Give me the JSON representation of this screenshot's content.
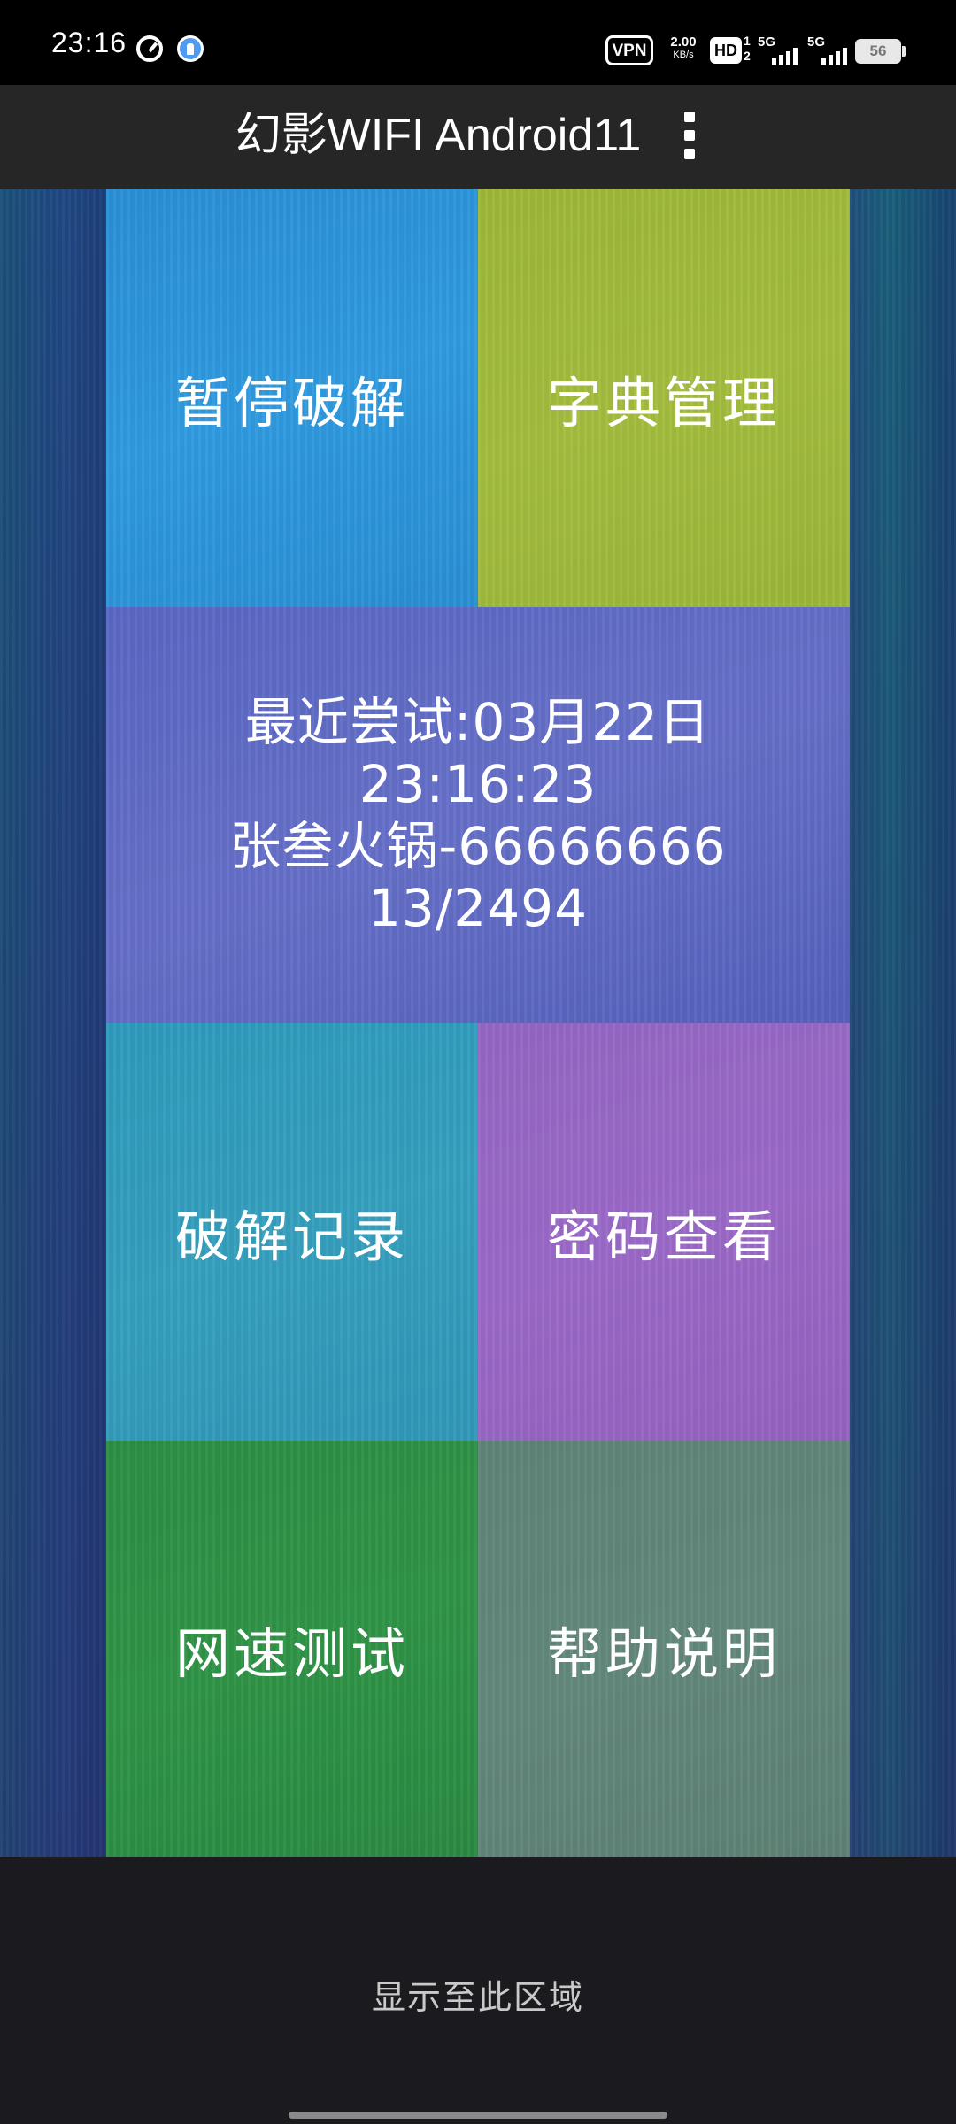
{
  "status_bar": {
    "time": "23:16",
    "vpn": "VPN",
    "net_speed_value": "2.00",
    "net_speed_unit": "KB/s",
    "hd_label": "HD",
    "hd_sub_top": "1",
    "hd_sub_bottom": "2",
    "signal_1_label": "5G",
    "signal_2_label": "5G",
    "battery": "56"
  },
  "title_bar": {
    "title": "幻影WIFI Android11"
  },
  "tiles": {
    "pause_crack": "暂停破解",
    "dictionary_manage": "字典管理",
    "recent_attempt": {
      "line1": "最近尝试:03月22日",
      "line2": "23:16:23",
      "line3": "张叁火锅-66666666",
      "line4": "13/2494"
    },
    "crack_records": "破解记录",
    "password_view": "密码查看",
    "speed_test": "网速测试",
    "help": "帮助说明"
  },
  "footer": {
    "text": "显示至此区域"
  }
}
